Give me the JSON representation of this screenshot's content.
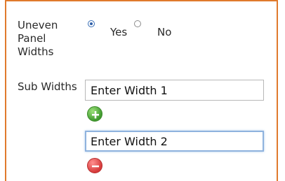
{
  "uneven_panel": {
    "label": "Uneven Panel Widths",
    "options": [
      {
        "label": "Yes",
        "checked": true
      },
      {
        "label": "No",
        "checked": false
      }
    ]
  },
  "sub_widths": {
    "label": "Sub Widths",
    "fields": [
      {
        "value": "Enter Width 1"
      },
      {
        "value": "Enter Width 2"
      }
    ],
    "add_icon": "plus-circle-green",
    "remove_icon": "minus-circle-red"
  },
  "colors": {
    "border_accent": "#e07a2c",
    "focus_ring": "#8fb3de",
    "add_green": "#3f9a2e",
    "remove_red": "#d63a3a"
  }
}
